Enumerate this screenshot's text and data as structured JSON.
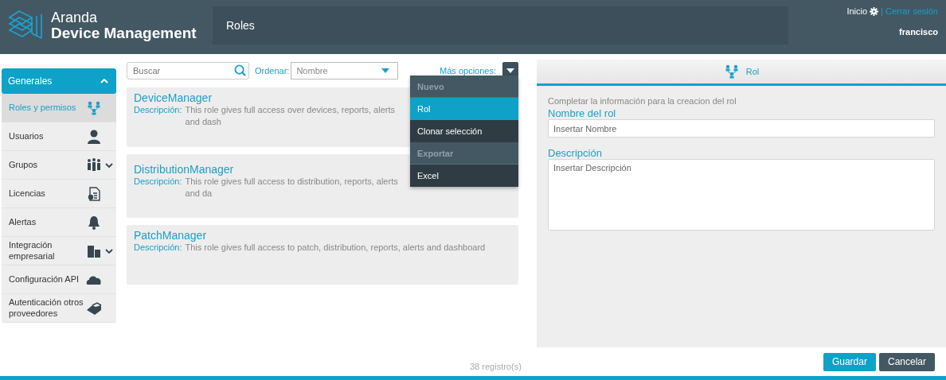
{
  "header": {
    "brand_top": "Aranda",
    "brand_bottom": "Device Management",
    "page_title": "Roles",
    "home_link": "Inicio",
    "separator": "|",
    "logout_link": "Cerrar sesión",
    "user": "francisco"
  },
  "sidebar": {
    "section": {
      "label": "Generales",
      "expanded": true
    },
    "items": [
      {
        "label": "Roles y permisos",
        "selected": true,
        "expandable": false
      },
      {
        "label": "Usuarios",
        "selected": false,
        "expandable": false
      },
      {
        "label": "Grupos",
        "selected": false,
        "expandable": true
      },
      {
        "label": "Licencias",
        "selected": false,
        "expandable": false
      },
      {
        "label": "Alertas",
        "selected": false,
        "expandable": false
      },
      {
        "label": "Integración empresarial",
        "selected": false,
        "expandable": true
      },
      {
        "label": "Configuración API",
        "selected": false,
        "expandable": false
      },
      {
        "label": "Autenticación otros proveedores",
        "selected": false,
        "expandable": false
      }
    ]
  },
  "toolbar": {
    "search": {
      "placeholder": "Buscar"
    },
    "sort_label": "Ordenar:",
    "sort_value": "Nombre",
    "more_label": "Más opciones:"
  },
  "menu": [
    {
      "label": "Nuevo",
      "kind": "header",
      "selected": false
    },
    {
      "label": "Rol",
      "kind": "item",
      "selected": true
    },
    {
      "label": "Clonar selección",
      "kind": "item",
      "selected": false
    },
    {
      "label": "Exportar",
      "kind": "header",
      "selected": false
    },
    {
      "label": "Excel",
      "kind": "item",
      "selected": false
    }
  ],
  "roles": [
    {
      "name": "DeviceManager",
      "description_label": "Descripción:",
      "description": "This role gives full access over devices, reports, alerts and dash"
    },
    {
      "name": "DistributionManager",
      "description_label": "Descripción:",
      "description": "This role gives full access to distribution, reports, alerts and da"
    },
    {
      "name": "PatchManager",
      "description_label": "Descripción:",
      "description": "This role gives full access to patch, distribution, reports, alerts and dashboard"
    }
  ],
  "form": {
    "tab": "Rol",
    "intro": "Completar la información para la creacion del rol",
    "name_label": "Nombre del rol",
    "name_placeholder": "Insertar Nombre",
    "description_label": "Descripción",
    "description_placeholder": "Insertar Descripción"
  },
  "footer": {
    "count": "38 registro(s)",
    "buttons": [
      {
        "label": "Guardar",
        "kind": "primary"
      },
      {
        "label": "Cancelar",
        "kind": "secondary"
      }
    ]
  }
}
